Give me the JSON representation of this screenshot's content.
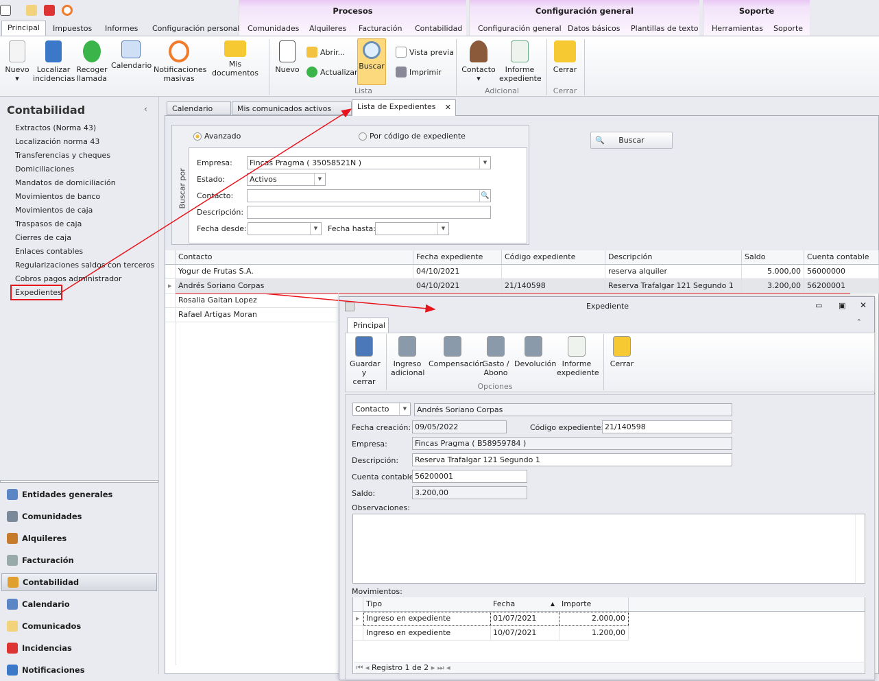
{
  "qat": {
    "icons": [
      "app-icon",
      "mail-icon",
      "incidencias-icon",
      "notifications-icon"
    ]
  },
  "context_groups": [
    {
      "label": "Procesos"
    },
    {
      "label": "Configuración general"
    },
    {
      "label": "Soporte"
    }
  ],
  "tabs": [
    "Principal",
    "Impuestos",
    "Informes",
    "Configuración personal",
    "Comunidades",
    "Alquileres",
    "Facturación",
    "Contabilidad",
    "Configuración general",
    "Datos básicos",
    "Plantillas de texto",
    "Herramientas",
    "Soporte"
  ],
  "ribbon": {
    "nuevo": "Nuevo",
    "localizar": "Localizar incidencias",
    "recoger": "Recoger llamada",
    "calendario": "Calendario",
    "notificaciones": "Notificaciones masivas",
    "mis_documentos": "Mis documentos",
    "nuevo2": "Nuevo",
    "abrir": "Abrir...",
    "actualizar": "Actualizar",
    "buscar": "Buscar",
    "vista_previa": "Vista previa",
    "imprimir": "Imprimir",
    "group_lista": "Lista",
    "contacto": "Contacto",
    "informe": "Informe expediente",
    "group_adicional": "Adicional",
    "cerrar": "Cerrar",
    "group_cerrar": "Cerrar"
  },
  "sidebar": {
    "title": "Contabilidad",
    "items": [
      "Extractos (Norma 43)",
      "Localización norma 43",
      "Transferencias y cheques",
      "Domiciliaciones",
      "Mandatos de domiciliación",
      "Movimientos de banco",
      "Movimientos de caja",
      "Traspasos de caja",
      "Cierres de caja",
      "Enlaces contables",
      "Regularizaciones saldos con terceros",
      "Cobros pagos administrador",
      "Expedientes"
    ],
    "nav": [
      "Entidades generales",
      "Comunidades",
      "Alquileres",
      "Facturación",
      "Contabilidad",
      "Calendario",
      "Comunicados",
      "Incidencias",
      "Notificaciones"
    ],
    "active_nav": "Contabilidad"
  },
  "doc_tabs": [
    "Calendario",
    "Mis comunicados activos",
    "Lista de Expedientes"
  ],
  "search": {
    "buscar_por": "Buscar por",
    "radio_avanzado": "Avanzado",
    "radio_codigo": "Por código de expediente",
    "empresa_label": "Empresa:",
    "empresa": "Fincas Pragma ( 35058521N )",
    "estado_label": "Estado:",
    "estado": "Activos",
    "contacto_label": "Contacto:",
    "contacto": "",
    "descripcion_label": "Descripción:",
    "descripcion": "",
    "fecha_desde_label": "Fecha desde:",
    "fecha_hasta_label": "Fecha hasta:",
    "buscar_button": "Buscar"
  },
  "grid": {
    "columns": [
      "Contacto",
      "Fecha expediente",
      "Código expediente",
      "Descripción",
      "Saldo",
      "Cuenta contable"
    ],
    "rows": [
      [
        "Yogur de Frutas S.A.",
        "04/10/2021",
        "",
        "reserva alquiler",
        "5.000,00",
        "56000000"
      ],
      [
        "Andrés Soriano Corpas",
        "04/10/2021",
        "21/140598",
        "Reserva Trafalgar 121 Segundo 1",
        "3.200,00",
        "56200001"
      ],
      [
        "Rosalia Gaitan Lopez",
        "",
        "",
        "",
        "",
        ""
      ],
      [
        "Rafael Artigas Moran",
        "",
        "",
        "",
        "",
        ""
      ]
    ]
  },
  "dialog": {
    "title": "Expediente",
    "tab": "Principal",
    "buttons": [
      "Guardar y cerrar",
      "Ingreso adicional",
      "Compensación",
      "Gasto / Abono",
      "Devolución",
      "Informe expediente",
      "Cerrar"
    ],
    "group_opciones": "Opciones",
    "contacto_select": "Contacto",
    "contacto": "Andrés Soriano Corpas",
    "fecha_creacion_label": "Fecha creación:",
    "fecha_creacion": "09/05/2022",
    "codigo_label": "Código expediente:",
    "codigo": "21/140598",
    "empresa_label": "Empresa:",
    "empresa": "Fincas Pragma ( B58959784 )",
    "descripcion_label": "Descripción:",
    "descripcion": "Reserva Trafalgar 121 Segundo 1",
    "cuenta_label": "Cuenta contable:",
    "cuenta": "56200001",
    "saldo_label": "Saldo:",
    "saldo": "3.200,00",
    "observaciones_label": "Observaciones:",
    "movimientos_label": "Movimientos:",
    "mov_columns": [
      "Tipo",
      "Fecha",
      "Importe"
    ],
    "mov_rows": [
      [
        "Ingreso en expediente",
        "01/07/2021",
        "2.000,00"
      ],
      [
        "Ingreso en expediente",
        "10/07/2021",
        "1.200,00"
      ]
    ],
    "navigator": "Registro 1 de 2"
  },
  "colors": {
    "annotation": "#e8141c",
    "selected_button": "#fcd97c",
    "accent_context": "#e8c8f4"
  }
}
